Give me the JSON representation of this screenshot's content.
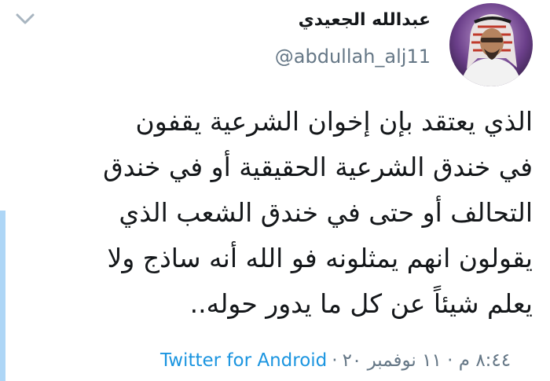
{
  "author": {
    "name": "عبدالله الجعيدي",
    "handle": "@abdullah_alj11"
  },
  "tweet": {
    "lines": [
      "الذي يعتقد بإن إخوان الشرعية يقفون",
      "في خندق الشرعية الحقيقية أو في خندق",
      "التحالف أو حتى في خندق الشعب الذي",
      "يقولون انهم يمثلونه فو الله أنه ساذج ولا",
      "يعلم شيئاً عن كل ما يدور حوله.."
    ]
  },
  "meta": {
    "source": "Twitter for Android",
    "separator": "·",
    "datetime": "٨:٤٤ م · ١١ نوفمبر ٢٠"
  },
  "icons": {
    "menu": "chevron-down-icon",
    "avatar": "profile-photo"
  },
  "colors": {
    "link": "#1b95e0",
    "secondary_text": "#657786",
    "thread_line": "#aed6f6"
  }
}
